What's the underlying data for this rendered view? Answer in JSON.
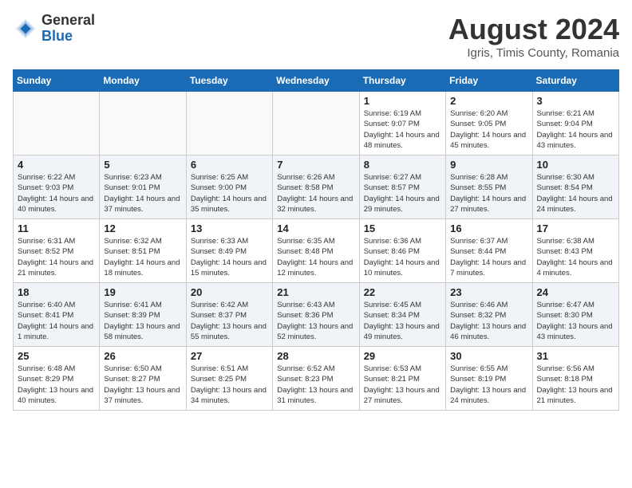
{
  "header": {
    "logo_general": "General",
    "logo_blue": "Blue",
    "month_year": "August 2024",
    "location": "Igris, Timis County, Romania"
  },
  "weekdays": [
    "Sunday",
    "Monday",
    "Tuesday",
    "Wednesday",
    "Thursday",
    "Friday",
    "Saturday"
  ],
  "weeks": [
    [
      {
        "day": "",
        "sunrise": "",
        "sunset": "",
        "daylight": ""
      },
      {
        "day": "",
        "sunrise": "",
        "sunset": "",
        "daylight": ""
      },
      {
        "day": "",
        "sunrise": "",
        "sunset": "",
        "daylight": ""
      },
      {
        "day": "",
        "sunrise": "",
        "sunset": "",
        "daylight": ""
      },
      {
        "day": "1",
        "sunrise": "Sunrise: 6:19 AM",
        "sunset": "Sunset: 9:07 PM",
        "daylight": "Daylight: 14 hours and 48 minutes."
      },
      {
        "day": "2",
        "sunrise": "Sunrise: 6:20 AM",
        "sunset": "Sunset: 9:05 PM",
        "daylight": "Daylight: 14 hours and 45 minutes."
      },
      {
        "day": "3",
        "sunrise": "Sunrise: 6:21 AM",
        "sunset": "Sunset: 9:04 PM",
        "daylight": "Daylight: 14 hours and 43 minutes."
      }
    ],
    [
      {
        "day": "4",
        "sunrise": "Sunrise: 6:22 AM",
        "sunset": "Sunset: 9:03 PM",
        "daylight": "Daylight: 14 hours and 40 minutes."
      },
      {
        "day": "5",
        "sunrise": "Sunrise: 6:23 AM",
        "sunset": "Sunset: 9:01 PM",
        "daylight": "Daylight: 14 hours and 37 minutes."
      },
      {
        "day": "6",
        "sunrise": "Sunrise: 6:25 AM",
        "sunset": "Sunset: 9:00 PM",
        "daylight": "Daylight: 14 hours and 35 minutes."
      },
      {
        "day": "7",
        "sunrise": "Sunrise: 6:26 AM",
        "sunset": "Sunset: 8:58 PM",
        "daylight": "Daylight: 14 hours and 32 minutes."
      },
      {
        "day": "8",
        "sunrise": "Sunrise: 6:27 AM",
        "sunset": "Sunset: 8:57 PM",
        "daylight": "Daylight: 14 hours and 29 minutes."
      },
      {
        "day": "9",
        "sunrise": "Sunrise: 6:28 AM",
        "sunset": "Sunset: 8:55 PM",
        "daylight": "Daylight: 14 hours and 27 minutes."
      },
      {
        "day": "10",
        "sunrise": "Sunrise: 6:30 AM",
        "sunset": "Sunset: 8:54 PM",
        "daylight": "Daylight: 14 hours and 24 minutes."
      }
    ],
    [
      {
        "day": "11",
        "sunrise": "Sunrise: 6:31 AM",
        "sunset": "Sunset: 8:52 PM",
        "daylight": "Daylight: 14 hours and 21 minutes."
      },
      {
        "day": "12",
        "sunrise": "Sunrise: 6:32 AM",
        "sunset": "Sunset: 8:51 PM",
        "daylight": "Daylight: 14 hours and 18 minutes."
      },
      {
        "day": "13",
        "sunrise": "Sunrise: 6:33 AM",
        "sunset": "Sunset: 8:49 PM",
        "daylight": "Daylight: 14 hours and 15 minutes."
      },
      {
        "day": "14",
        "sunrise": "Sunrise: 6:35 AM",
        "sunset": "Sunset: 8:48 PM",
        "daylight": "Daylight: 14 hours and 12 minutes."
      },
      {
        "day": "15",
        "sunrise": "Sunrise: 6:36 AM",
        "sunset": "Sunset: 8:46 PM",
        "daylight": "Daylight: 14 hours and 10 minutes."
      },
      {
        "day": "16",
        "sunrise": "Sunrise: 6:37 AM",
        "sunset": "Sunset: 8:44 PM",
        "daylight": "Daylight: 14 hours and 7 minutes."
      },
      {
        "day": "17",
        "sunrise": "Sunrise: 6:38 AM",
        "sunset": "Sunset: 8:43 PM",
        "daylight": "Daylight: 14 hours and 4 minutes."
      }
    ],
    [
      {
        "day": "18",
        "sunrise": "Sunrise: 6:40 AM",
        "sunset": "Sunset: 8:41 PM",
        "daylight": "Daylight: 14 hours and 1 minute."
      },
      {
        "day": "19",
        "sunrise": "Sunrise: 6:41 AM",
        "sunset": "Sunset: 8:39 PM",
        "daylight": "Daylight: 13 hours and 58 minutes."
      },
      {
        "day": "20",
        "sunrise": "Sunrise: 6:42 AM",
        "sunset": "Sunset: 8:37 PM",
        "daylight": "Daylight: 13 hours and 55 minutes."
      },
      {
        "day": "21",
        "sunrise": "Sunrise: 6:43 AM",
        "sunset": "Sunset: 8:36 PM",
        "daylight": "Daylight: 13 hours and 52 minutes."
      },
      {
        "day": "22",
        "sunrise": "Sunrise: 6:45 AM",
        "sunset": "Sunset: 8:34 PM",
        "daylight": "Daylight: 13 hours and 49 minutes."
      },
      {
        "day": "23",
        "sunrise": "Sunrise: 6:46 AM",
        "sunset": "Sunset: 8:32 PM",
        "daylight": "Daylight: 13 hours and 46 minutes."
      },
      {
        "day": "24",
        "sunrise": "Sunrise: 6:47 AM",
        "sunset": "Sunset: 8:30 PM",
        "daylight": "Daylight: 13 hours and 43 minutes."
      }
    ],
    [
      {
        "day": "25",
        "sunrise": "Sunrise: 6:48 AM",
        "sunset": "Sunset: 8:29 PM",
        "daylight": "Daylight: 13 hours and 40 minutes."
      },
      {
        "day": "26",
        "sunrise": "Sunrise: 6:50 AM",
        "sunset": "Sunset: 8:27 PM",
        "daylight": "Daylight: 13 hours and 37 minutes."
      },
      {
        "day": "27",
        "sunrise": "Sunrise: 6:51 AM",
        "sunset": "Sunset: 8:25 PM",
        "daylight": "Daylight: 13 hours and 34 minutes."
      },
      {
        "day": "28",
        "sunrise": "Sunrise: 6:52 AM",
        "sunset": "Sunset: 8:23 PM",
        "daylight": "Daylight: 13 hours and 31 minutes."
      },
      {
        "day": "29",
        "sunrise": "Sunrise: 6:53 AM",
        "sunset": "Sunset: 8:21 PM",
        "daylight": "Daylight: 13 hours and 27 minutes."
      },
      {
        "day": "30",
        "sunrise": "Sunrise: 6:55 AM",
        "sunset": "Sunset: 8:19 PM",
        "daylight": "Daylight: 13 hours and 24 minutes."
      },
      {
        "day": "31",
        "sunrise": "Sunrise: 6:56 AM",
        "sunset": "Sunset: 8:18 PM",
        "daylight": "Daylight: 13 hours and 21 minutes."
      }
    ]
  ]
}
